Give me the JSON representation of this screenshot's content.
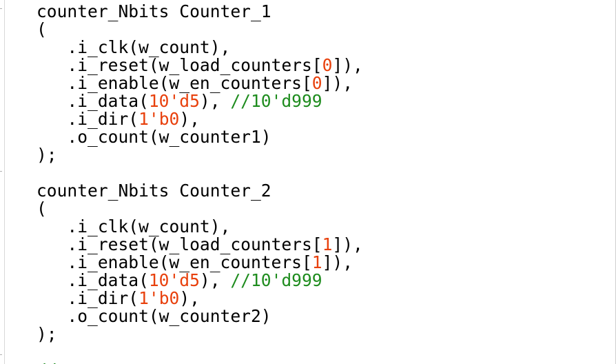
{
  "colors": {
    "text": "#000000",
    "number": "#e8400c",
    "comment": "#1e8c1e",
    "background": "#ffffff"
  },
  "code_lines": [
    [
      {
        "t": "counter_Nbits Counter_1",
        "c": "text"
      }
    ],
    [
      {
        "t": "(",
        "c": "text"
      }
    ],
    [
      {
        "t": "   .i_clk(w_count),",
        "c": "text"
      }
    ],
    [
      {
        "t": "   .i_reset(w_load_counters[",
        "c": "text"
      },
      {
        "t": "0",
        "c": "num"
      },
      {
        "t": "]),",
        "c": "text"
      }
    ],
    [
      {
        "t": "   .i_enable(w_en_counters[",
        "c": "text"
      },
      {
        "t": "0",
        "c": "num"
      },
      {
        "t": "]),",
        "c": "text"
      }
    ],
    [
      {
        "t": "   .i_data(",
        "c": "text"
      },
      {
        "t": "10'd5",
        "c": "num"
      },
      {
        "t": "), ",
        "c": "text"
      },
      {
        "t": "//10'd999",
        "c": "cmt"
      }
    ],
    [
      {
        "t": "   .i_dir(",
        "c": "text"
      },
      {
        "t": "1'b0",
        "c": "num"
      },
      {
        "t": "),",
        "c": "text"
      }
    ],
    [
      {
        "t": "   .o_count(w_counter1)",
        "c": "text"
      }
    ],
    [
      {
        "t": ");",
        "c": "text"
      }
    ],
    [
      {
        "t": "",
        "c": "text"
      }
    ],
    [
      {
        "t": "counter_Nbits Counter_2",
        "c": "text"
      }
    ],
    [
      {
        "t": "(",
        "c": "text"
      }
    ],
    [
      {
        "t": "   .i_clk(w_count),",
        "c": "text"
      }
    ],
    [
      {
        "t": "   .i_reset(w_load_counters[",
        "c": "text"
      },
      {
        "t": "1",
        "c": "num"
      },
      {
        "t": "]),",
        "c": "text"
      }
    ],
    [
      {
        "t": "   .i_enable(w_en_counters[",
        "c": "text"
      },
      {
        "t": "1",
        "c": "num"
      },
      {
        "t": "]),",
        "c": "text"
      }
    ],
    [
      {
        "t": "   .i_data(",
        "c": "text"
      },
      {
        "t": "10'd5",
        "c": "num"
      },
      {
        "t": "), ",
        "c": "text"
      },
      {
        "t": "//10'd999",
        "c": "cmt"
      }
    ],
    [
      {
        "t": "   .i_dir(",
        "c": "text"
      },
      {
        "t": "1'b0",
        "c": "num"
      },
      {
        "t": "),",
        "c": "text"
      }
    ],
    [
      {
        "t": "   .o_count(w_counter2)",
        "c": "text"
      }
    ],
    [
      {
        "t": ");",
        "c": "text"
      }
    ],
    [
      {
        "t": "",
        "c": "text"
      }
    ],
    [
      {
        "t": "//",
        "c": "cmt"
      }
    ]
  ]
}
